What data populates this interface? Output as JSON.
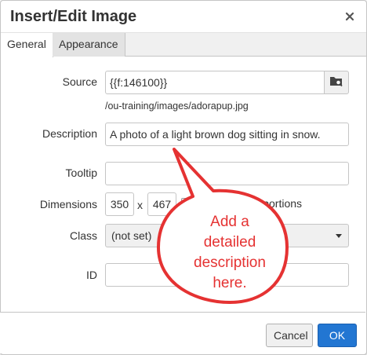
{
  "dialog": {
    "title": "Insert/Edit Image",
    "close_icon": "close-icon"
  },
  "tabs": [
    {
      "label": "General",
      "active": true
    },
    {
      "label": "Appearance",
      "active": false
    }
  ],
  "form": {
    "source_label": "Source",
    "source_value": "{{f:146100}}",
    "browse_icon": "folder-search-icon",
    "source_path": "/ou-training/images/adorapup.jpg",
    "description_label": "Description",
    "description_value": "A photo of a light brown dog sitting in snow.",
    "tooltip_label": "Tooltip",
    "tooltip_value": "",
    "dimensions_label": "Dimensions",
    "width_value": "350",
    "dimension_separator": "x",
    "height_value": "467",
    "constrain_label": "proportions",
    "class_label": "Class",
    "class_value": "(not set)",
    "id_label": "ID",
    "id_value": ""
  },
  "footer": {
    "cancel_label": "Cancel",
    "ok_label": "OK"
  },
  "callout": {
    "line1": "Add a",
    "line2": "detailed",
    "line3": "description",
    "line4": "here.",
    "color": "#e53232"
  },
  "colors": {
    "primary_button": "#2276d2",
    "border": "#c5c5c5",
    "tab_bar": "#f0f0f0"
  }
}
